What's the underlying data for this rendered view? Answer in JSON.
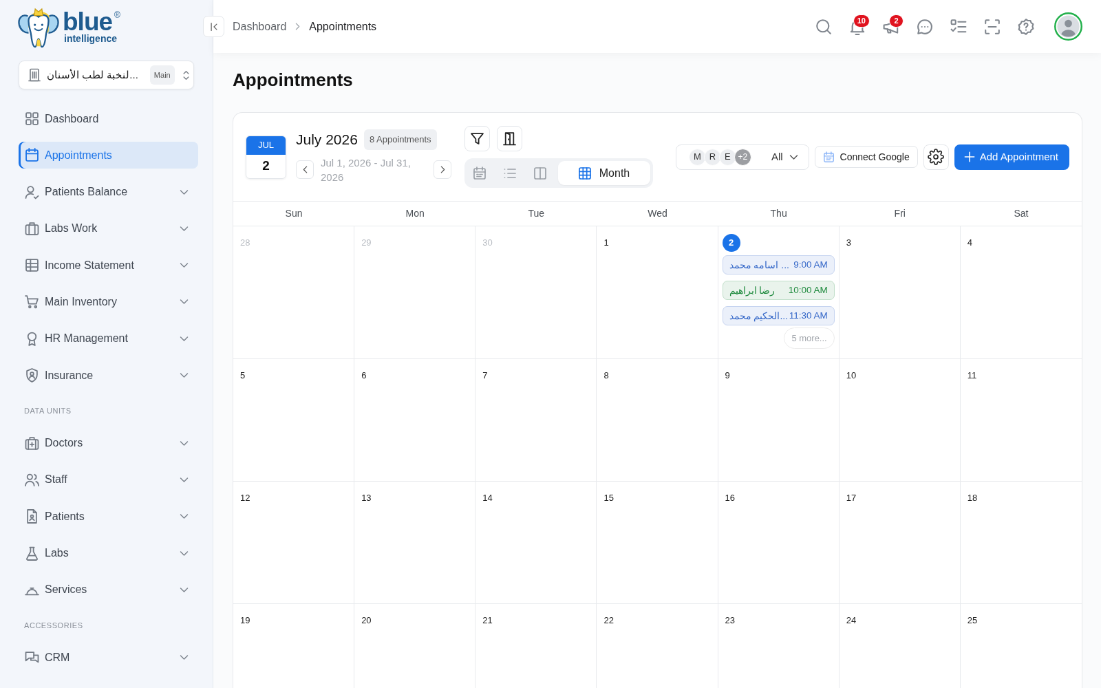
{
  "sidebar": {
    "logo": {
      "wordmark": "blue",
      "mark": "®",
      "tagline": "intelligence"
    },
    "branch": {
      "name": "لنخبة لطب الأسنان...",
      "tag": "Main"
    },
    "groups": [
      {
        "items": [
          {
            "label": "Dashboard",
            "selected": false,
            "expandable": false
          },
          {
            "label": "Appointments",
            "selected": true,
            "expandable": false
          },
          {
            "label": "Patients Balance",
            "selected": false,
            "expandable": true
          },
          {
            "label": "Labs Work",
            "selected": false,
            "expandable": true
          },
          {
            "label": "Income Statement",
            "selected": false,
            "expandable": true
          },
          {
            "label": "Main Inventory",
            "selected": false,
            "expandable": true
          },
          {
            "label": "HR Management",
            "selected": false,
            "expandable": true
          },
          {
            "label": "Insurance",
            "selected": false,
            "expandable": true
          }
        ]
      },
      {
        "heading": "DATA UNITS",
        "items": [
          {
            "label": "Doctors",
            "selected": false,
            "expandable": true
          },
          {
            "label": "Staff",
            "selected": false,
            "expandable": true
          },
          {
            "label": "Patients",
            "selected": false,
            "expandable": true
          },
          {
            "label": "Labs",
            "selected": false,
            "expandable": true
          },
          {
            "label": "Services",
            "selected": false,
            "expandable": true
          }
        ]
      },
      {
        "heading": "ACCESSORIES",
        "items": [
          {
            "label": "CRM",
            "selected": false,
            "expandable": true
          }
        ]
      }
    ]
  },
  "header": {
    "breadcrumb": [
      {
        "label": "Dashboard",
        "current": false
      },
      {
        "label": "Appointments",
        "current": true
      }
    ],
    "notification_count": "10",
    "announcement_count": "2"
  },
  "page_title": "Appointments",
  "calendar": {
    "date_tile": {
      "month": "JUL",
      "day": "2"
    },
    "title": "July 2026",
    "count": "8 Appointments",
    "range": "Jul 1, 2026 - Jul 31, 2026",
    "views": [
      {
        "selected": false
      },
      {
        "selected": false
      },
      {
        "selected": false
      },
      {
        "label": "Month",
        "selected": true
      }
    ],
    "staff_filter": {
      "initials": [
        "M",
        "R",
        "E"
      ],
      "more": "+2",
      "value": "All"
    },
    "connect_button": "Connect Google",
    "add_button": "Add Appointment",
    "weekdays": [
      "Sun",
      "Mon",
      "Tue",
      "Wed",
      "Thu",
      "Fri",
      "Sat"
    ],
    "weeks": [
      {
        "days": [
          {
            "day": "28",
            "other_month": true,
            "today": false
          },
          {
            "day": "29",
            "other_month": true,
            "today": false
          },
          {
            "day": "30",
            "other_month": true,
            "today": false
          },
          {
            "day": "1",
            "other_month": false,
            "today": false
          },
          {
            "day": "2",
            "other_month": false,
            "today": true,
            "events": [
              {
                "patient": "اسامه محمد ...",
                "time": "9:00 AM",
                "color": "#3467c8"
              },
              {
                "patient": "رضا ابراهيم",
                "time": "10:00 AM",
                "color": "#1f8a3e"
              },
              {
                "patient": "الحكيم محمد...",
                "time": "11:30 AM",
                "color": "#3467c8"
              }
            ],
            "more": "5 more..."
          },
          {
            "day": "3",
            "other_month": false,
            "today": false
          },
          {
            "day": "4",
            "other_month": false,
            "today": false
          }
        ]
      },
      {
        "days": [
          {
            "day": "5",
            "other_month": false,
            "today": false
          },
          {
            "day": "6",
            "other_month": false,
            "today": false
          },
          {
            "day": "7",
            "other_month": false,
            "today": false
          },
          {
            "day": "8",
            "other_month": false,
            "today": false
          },
          {
            "day": "9",
            "other_month": false,
            "today": false
          },
          {
            "day": "10",
            "other_month": false,
            "today": false
          },
          {
            "day": "11",
            "other_month": false,
            "today": false
          }
        ]
      },
      {
        "days": [
          {
            "day": "12",
            "other_month": false,
            "today": false
          },
          {
            "day": "13",
            "other_month": false,
            "today": false
          },
          {
            "day": "14",
            "other_month": false,
            "today": false
          },
          {
            "day": "15",
            "other_month": false,
            "today": false
          },
          {
            "day": "16",
            "other_month": false,
            "today": false
          },
          {
            "day": "17",
            "other_month": false,
            "today": false
          },
          {
            "day": "18",
            "other_month": false,
            "today": false
          }
        ]
      },
      {
        "days": [
          {
            "day": "19",
            "other_month": false,
            "today": false
          },
          {
            "day": "20",
            "other_month": false,
            "today": false
          },
          {
            "day": "21",
            "other_month": false,
            "today": false
          },
          {
            "day": "22",
            "other_month": false,
            "today": false
          },
          {
            "day": "23",
            "other_month": false,
            "today": false
          },
          {
            "day": "24",
            "other_month": false,
            "today": false
          },
          {
            "day": "25",
            "other_month": false,
            "today": false
          }
        ]
      }
    ]
  }
}
